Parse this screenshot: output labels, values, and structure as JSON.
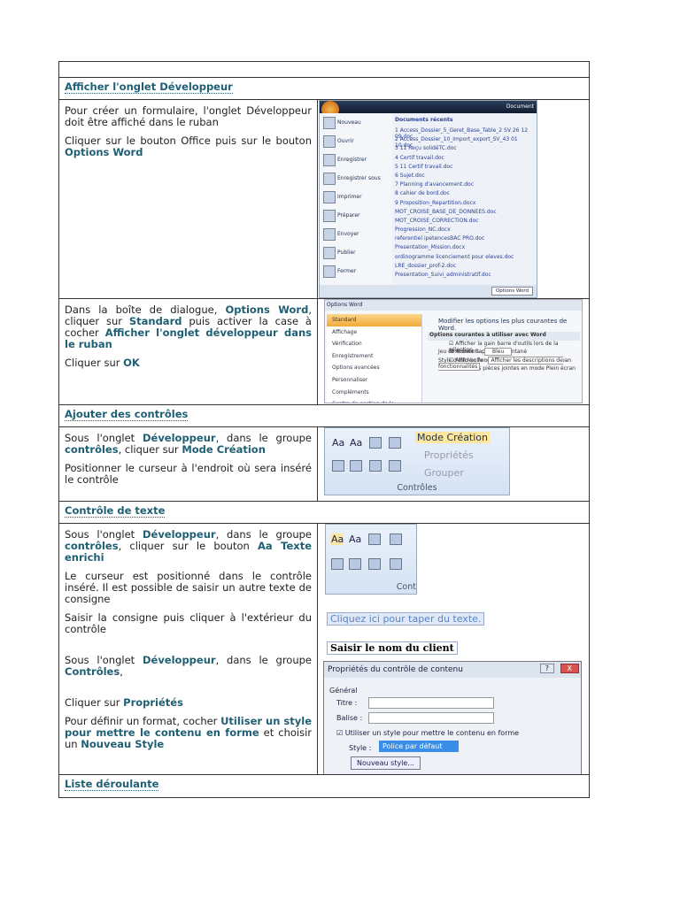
{
  "sections": [
    {
      "heading": "Afficher l'onglet Développeur"
    },
    {
      "heading": "Ajouter des contrôles"
    },
    {
      "heading": "Contrôle de texte"
    },
    {
      "heading": "Liste déroulante"
    }
  ],
  "row1": {
    "p1": "Pour créer un formulaire, l'onglet Développeur doit être affiché dans le ruban",
    "p2a": "Cliquer sur le bouton Office puis sur le bouton ",
    "p2b": "Options Word"
  },
  "row2": {
    "a": "Dans la boîte de dialogue, ",
    "b": "Options Word",
    ",": ",",
    "c": " cliquer sur ",
    "d": "Standard",
    "e": " puis activer la case à cocher ",
    "f": "Afficher l'onglet développeur dans le ruban",
    "p2a": "Cliquer sur ",
    "p2b": "OK"
  },
  "row3": {
    "a": "Sous l'onglet ",
    "b": "Développeur",
    "c": ", dans le groupe ",
    "d": "contrôles",
    "e": ", cliquer sur ",
    "f": "Mode Création",
    "p2": "Positionner le curseur à l'endroit où sera inséré le contrôle"
  },
  "row4": {
    "a": "Sous l'onglet ",
    "b": "Développeur",
    "c": ", dans le groupe ",
    "d": "contrôles",
    "e": ", cliquer sur le bouton ",
    "f": "Aa Texte enrichi",
    "p2": "Le curseur est positionné dans le contrôle inséré. Il est possible de saisir un autre texte de consigne",
    "p3": "Saisir la consigne puis cliquer à l'extérieur du contrôle",
    "p4a": "Sous l'onglet ",
    "p4b": "Développeur",
    "p4c": ", dans le groupe ",
    "p4d": "Contrôles",
    ",": ",",
    "p5a": "Cliquer sur ",
    "p5b": "Propriétés",
    "p6a": "Pour définir un format, cocher ",
    "p6b": "Utiliser un style pour mettre le contenu en forme",
    "p6c": " et choisir un ",
    "p6d": "Nouveau Style"
  },
  "office_menu": {
    "title": "Document",
    "left": [
      "Nouveau",
      "Ouvrir",
      "Enregistrer",
      "Enregistrer sous",
      "Imprimer",
      "Préparer",
      "Envoyer",
      "Publier",
      "Fermer"
    ],
    "recent_title": "Documents récents",
    "recent": [
      "1 Access_Dossier_5_Geret_Base_Table_2 SV 26 12 09.doc",
      "2 Access_Dossier_10_Import_export_SV_43 01 10.doc",
      "3 11 Reçu solidéTC.doc",
      "4 Certif travail.doc",
      "5 11 Certif travail.doc",
      "6 Sujet.doc",
      "7 Planning d'avancement.doc",
      "8 cahier de bord.doc",
      "9 Proposition_Repartition.docx",
      "MOT_CROISE_BASE_DE_DONNEES.doc",
      "MOT_CROISE_CORRECTION.doc",
      "Progression_NC.docx",
      "referentiel  ipetencesBAC  PRO.doc",
      "Presentation_Mission.docx",
      "ordinogramme licenciement pour eleves.doc",
      "LRE_dossier_prof-2.doc",
      "Presentation_Suivi_administratif.doc"
    ],
    "button": "Options Word"
  },
  "options_dialog": {
    "title": "Options Word",
    "left": [
      "Standard",
      "Affichage",
      "Vérification",
      "Enregistrement",
      "Options avancées",
      "Personnaliser",
      "Compléments",
      "Centre de gestion de la confidentialité"
    ],
    "header": "Modifier les options les plus courantes de Word.",
    "group": "Options courantes à utiliser avec Word",
    "checks": [
      "Afficher la gain barre d'outils lors de la sélection",
      "Activer l'aperçu instantané",
      "Afficher l'onglet Développeur dans le ruban",
      "Ouvrir les pièces jointes en mode Plein écran"
    ],
    "color_label": "Jeu de couleurs :",
    "color_value": "Bleu",
    "tooltip_label": "Style d'info-bulle :",
    "tooltip_value": "Afficher les descriptions de fonctionnalités"
  },
  "ribbon": {
    "mode": "Mode Création",
    "props": "Propriétés",
    "group_btn": "Grouper",
    "group_name": "Contrôles",
    "aa1": "Aa",
    "aa2": "Aa",
    "short_name": "Cont"
  },
  "content_control": {
    "placeholder": "Cliquez ici pour taper du texte.",
    "typed": "Saisir le nom du client"
  },
  "props_dialog": {
    "title": "Propriétés du contrôle de contenu",
    "help": "?",
    "close": "X",
    "general": "Général",
    "titre": "Titre :",
    "balise": "Balise :",
    "use_style": "Utiliser un style pour mettre le contenu en forme",
    "style_label": "Style :",
    "style_value": "Police par défaut",
    "new_style": "Nouveau style..."
  }
}
